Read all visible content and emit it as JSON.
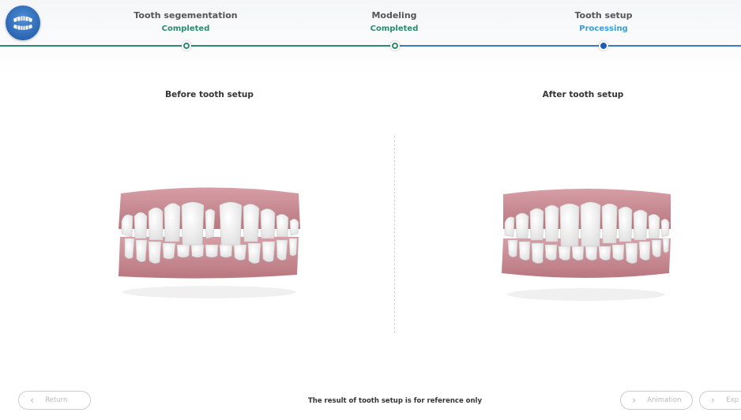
{
  "steps": [
    {
      "name": "Tooth segementation",
      "status": "Completed",
      "state": "done"
    },
    {
      "name": "Modeling",
      "status": "Completed",
      "state": "done"
    },
    {
      "name": "Tooth setup",
      "status": "Processing",
      "state": "active"
    }
  ],
  "panels": {
    "before_title": "Before tooth setup",
    "after_title": "After tooth setup"
  },
  "footer": {
    "note": "The result of tooth setup is for reference only",
    "return_label": "Return",
    "animation_label": "Animation",
    "export_label": "Exp"
  },
  "colors": {
    "completed": "#2e8a6d",
    "processing": "#3b9bd6",
    "gum": "#c98b93",
    "progress_green": "#2e8a6d",
    "progress_blue": "#3b78c7"
  },
  "icons": {
    "logo": "teeth-logo-icon",
    "return": "chevron-left-icon",
    "animation": "chevron-right-icon",
    "export": "chevron-right-icon"
  }
}
